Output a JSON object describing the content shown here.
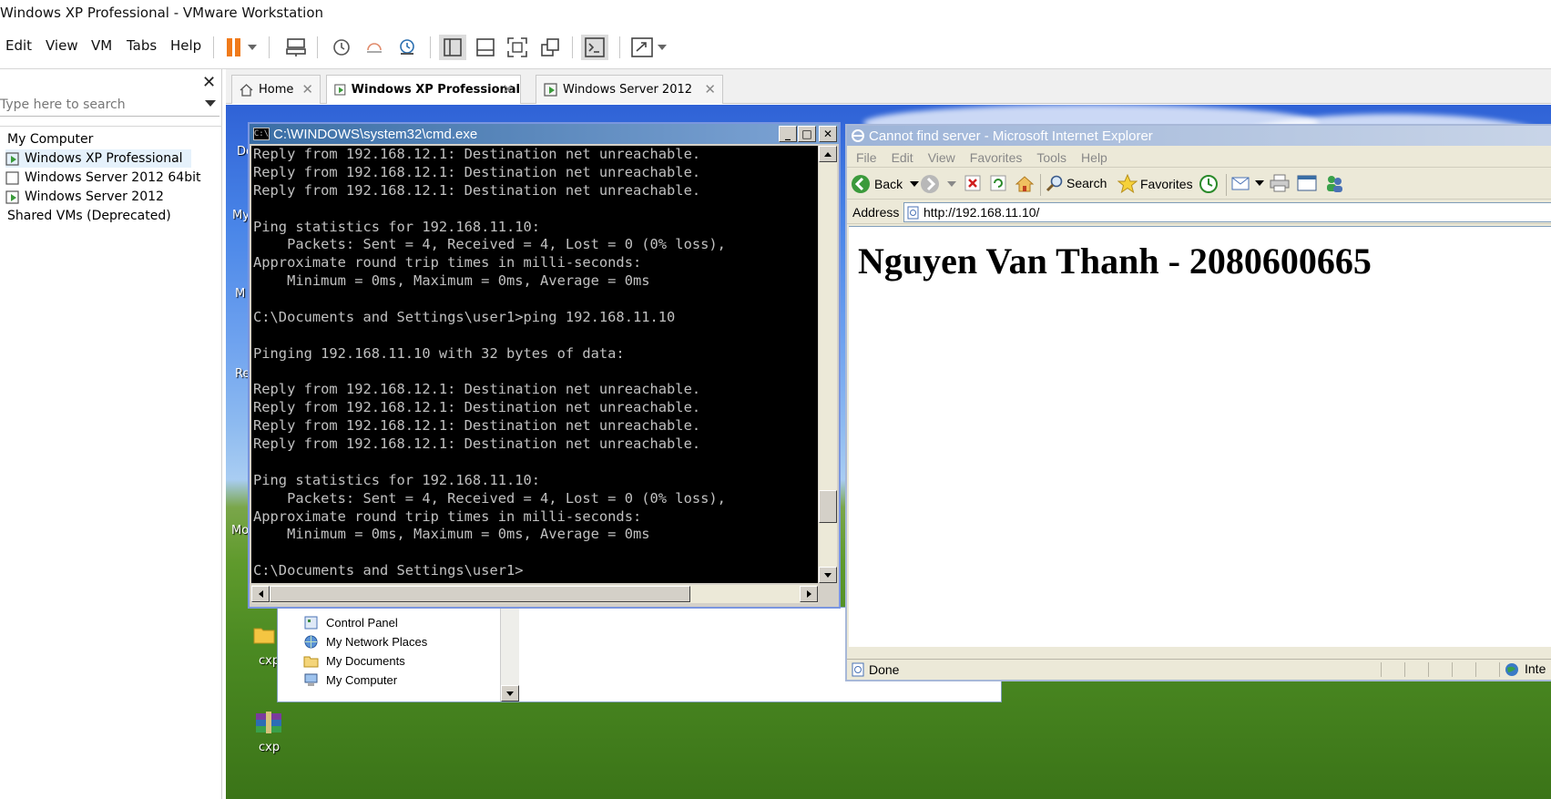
{
  "window": {
    "title": "Windows XP Professional - VMware Workstation"
  },
  "menu": [
    "Edit",
    "View",
    "VM",
    "Tabs",
    "Help"
  ],
  "library": {
    "search_placeholder": "Type here to search",
    "root": "My Computer",
    "vms": [
      "Windows XP Professional",
      "Windows Server 2012 64bit",
      "Windows Server 2012"
    ],
    "shared": "Shared VMs (Deprecated)"
  },
  "tabs": [
    {
      "label": "Home",
      "active": false
    },
    {
      "label": "Windows XP Professional",
      "active": true
    },
    {
      "label": "Windows Server 2012",
      "active": false
    }
  ],
  "desktop": {
    "icons": [
      "cxp",
      "cxp"
    ],
    "side_fragments": [
      "Do",
      "My",
      "M",
      "Re",
      "Mo"
    ]
  },
  "explorer": {
    "items": [
      "Control Panel",
      "My Network Places",
      "My Documents",
      "My Computer"
    ]
  },
  "cmd": {
    "title": "C:\\WINDOWS\\system32\\cmd.exe",
    "icon_text": "C:\\",
    "lines": [
      "Reply from 192.168.12.1: Destination net unreachable.",
      "Reply from 192.168.12.1: Destination net unreachable.",
      "Reply from 192.168.12.1: Destination net unreachable.",
      "",
      "Ping statistics for 192.168.11.10:",
      "    Packets: Sent = 4, Received = 4, Lost = 0 (0% loss),",
      "Approximate round trip times in milli-seconds:",
      "    Minimum = 0ms, Maximum = 0ms, Average = 0ms",
      "",
      "C:\\Documents and Settings\\user1>ping 192.168.11.10",
      "",
      "Pinging 192.168.11.10 with 32 bytes of data:",
      "",
      "Reply from 192.168.12.1: Destination net unreachable.",
      "Reply from 192.168.12.1: Destination net unreachable.",
      "Reply from 192.168.12.1: Destination net unreachable.",
      "Reply from 192.168.12.1: Destination net unreachable.",
      "",
      "Ping statistics for 192.168.11.10:",
      "    Packets: Sent = 4, Received = 4, Lost = 0 (0% loss),",
      "Approximate round trip times in milli-seconds:",
      "    Minimum = 0ms, Maximum = 0ms, Average = 0ms",
      "",
      "C:\\Documents and Settings\\user1>"
    ]
  },
  "ie": {
    "title": "Cannot find server - Microsoft Internet Explorer",
    "menu": [
      "File",
      "Edit",
      "View",
      "Favorites",
      "Tools",
      "Help"
    ],
    "toolbar": {
      "back": "Back",
      "search": "Search",
      "favorites": "Favorites"
    },
    "address_label": "Address",
    "url": "http://192.168.11.10/",
    "heading": "Nguyen Van Thanh - 2080600665",
    "status": "Done",
    "zone": "Inte"
  }
}
